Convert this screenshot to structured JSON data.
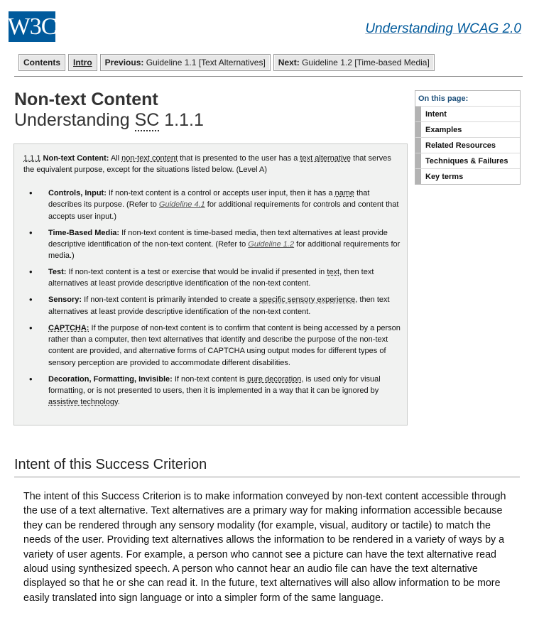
{
  "header": {
    "logo_text": "W3C",
    "doc_title": "Understanding WCAG 2.0"
  },
  "nav": {
    "contents": "Contents",
    "intro": "Intro",
    "previous_label": "Previous:",
    "previous_target": "Guideline 1.1 [Text Alternatives]",
    "next_label": "Next:",
    "next_target": "Guideline 1.2 [Time-based Media]"
  },
  "page": {
    "title": "Non-text Content",
    "subtitle_prefix": "Understanding",
    "subtitle_abbr": "SC",
    "subtitle_number": "1.1.1"
  },
  "criterion": {
    "number": "1.1.1",
    "name": "Non-text Content:",
    "t1": " All ",
    "t2": "non-text content",
    "t3": " that is presented to the user has a ",
    "t4": "text alternative",
    "t5": " that serves the equivalent purpose, except for the situations listed below. (Level A)",
    "items": [
      {
        "bullet": "•",
        "term": "Controls, Input:",
        "a": " If non-text content is a control or accepts user input, then it has a ",
        "b": "name",
        "c": " that describes its purpose. (Refer to ",
        "link": "Guideline 4.1",
        "d": " for additional requirements for controls and content that accepts user input.)"
      },
      {
        "bullet": "•",
        "term": "Time-Based Media:",
        "a": " If non-text content is time-based media, then text alternatives at least provide descriptive identification of the non-text content. (Refer to ",
        "link": "Guideline 1.2",
        "d": " for additional requirements for media.)"
      },
      {
        "bullet": "•",
        "term": "Test:",
        "a": " If non-text content is a test or exercise that would be invalid if presented in ",
        "b": "text",
        "c": ", then text alternatives at least provide descriptive identification of the non-text content."
      },
      {
        "bullet": "•",
        "term": "Sensory:",
        "a": " If non-text content is primarily intended to create a ",
        "b": "specific sensory experience",
        "c": ", then text alternatives at least provide descriptive identification of the non-text content."
      },
      {
        "bullet": "•",
        "term": "CAPTCHA:",
        "a": " If the purpose of non-text content is to confirm that content is being accessed by a person rather than a computer, then text alternatives that identify and describe the purpose of the non-text content are provided, and alternative forms of CAPTCHA using output modes for different types of sensory perception are provided to accommodate different disabilities."
      },
      {
        "bullet": "•",
        "term": "Decoration, Formatting, Invisible:",
        "a": " If non-text content is ",
        "b": "pure decoration",
        "c": ", is used only for visual formatting, or is not presented to users, then it is implemented in a way that it can be ignored by ",
        "e": "assistive technology",
        "f": "."
      }
    ]
  },
  "toc": {
    "heading": "On this page:",
    "items": [
      "Intent",
      "Examples",
      "Related Resources",
      "Techniques & Failures",
      "Key terms"
    ]
  },
  "intent": {
    "heading": "Intent of this Success Criterion",
    "body": "The intent of this Success Criterion is to make information conveyed by non-text content accessible through the use of a text alternative. Text alternatives are a primary way for making information accessible because they can be rendered through any sensory modality (for example, visual, auditory or tactile) to match the needs of the user. Providing text alternatives allows the information to be rendered in a variety of ways by a variety of user agents. For example, a person who cannot see a picture can have the text alternative read aloud using synthesized speech. A person who cannot hear an audio file can have the text alternative displayed so that he or she can read it. In the future, text alternatives will also allow information to be more easily translated into sign language or into a simpler form of the same language."
  }
}
